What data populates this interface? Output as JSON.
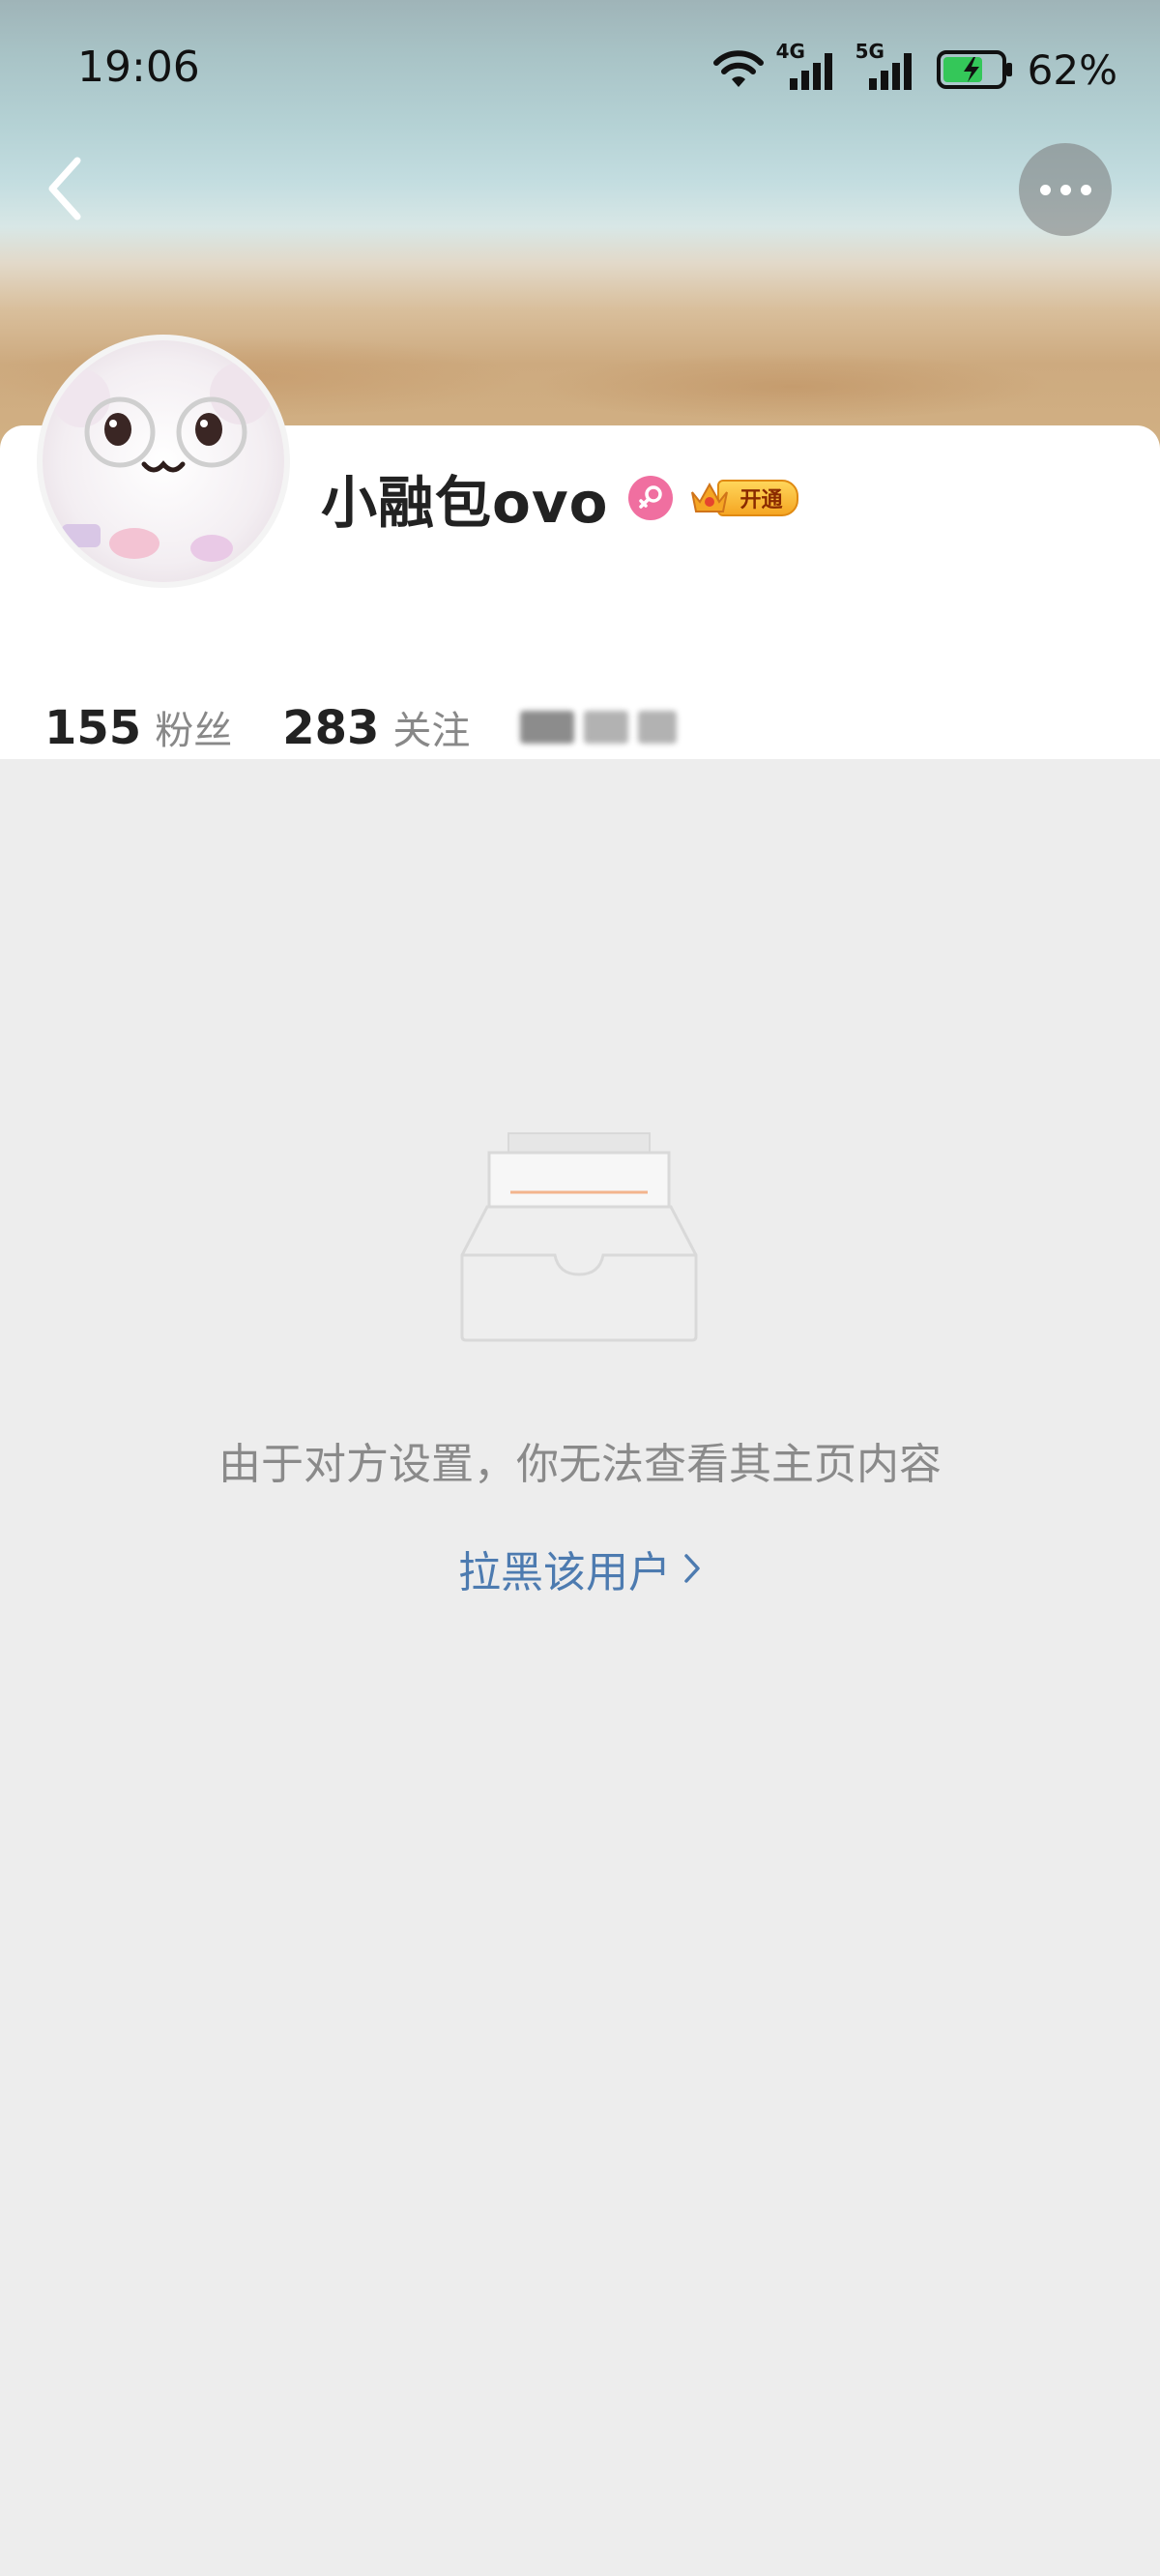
{
  "status_bar": {
    "time": "19:06",
    "network_4g": "4G",
    "network_5g": "5G",
    "battery": "62%"
  },
  "nav": {
    "back_icon": "chevron-left-icon",
    "more_icon": "more-horizontal-icon"
  },
  "profile": {
    "username": "小融包ovo",
    "gender": "female",
    "vip_label": "开通",
    "stats": [
      {
        "value": "155",
        "label": "粉丝"
      },
      {
        "value": "283",
        "label": "关注"
      }
    ]
  },
  "empty_state": {
    "message": "由于对方设置，你无法查看其主页内容",
    "action_label": "拉黑该用户"
  },
  "colors": {
    "page_background": "#ededed",
    "card_background": "#ffffff",
    "link_blue": "#4d7bb0",
    "female_pink": "#f06fa0",
    "vip_gold": "#f5a623"
  }
}
